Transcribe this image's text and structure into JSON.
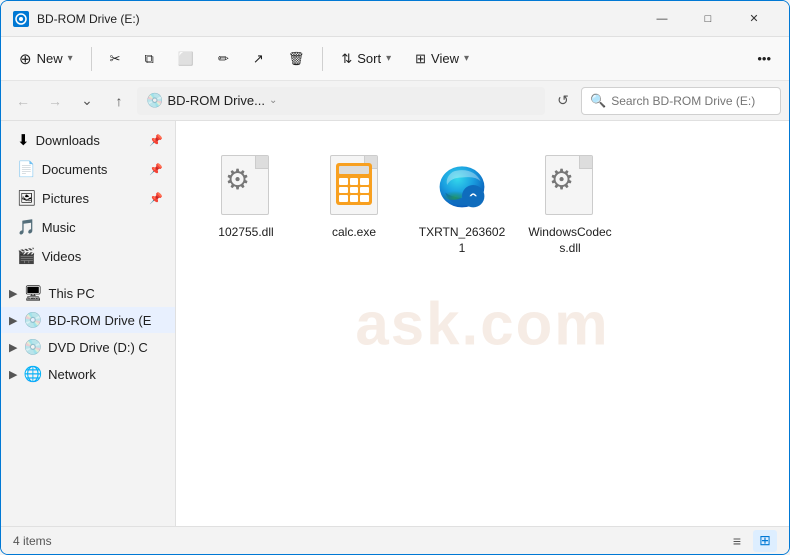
{
  "window": {
    "title": "BD-ROM Drive (E:)",
    "icon": "disc-icon"
  },
  "toolbar": {
    "new_label": "New",
    "new_chevron": "▾",
    "cut_icon": "✂",
    "copy_icon": "⧉",
    "paste_icon": "📋",
    "rename_icon": "✏",
    "share_icon": "↗",
    "delete_icon": "🗑",
    "sort_label": "Sort",
    "sort_icon": "⇅",
    "view_label": "View",
    "view_icon": "⊞",
    "more_icon": "•••"
  },
  "addressbar": {
    "back_disabled": true,
    "forward_disabled": true,
    "up_enabled": true,
    "path_icon": "💿",
    "path_text": "BD-ROM Drive...",
    "search_placeholder": "Search BD-ROM Drive (E:)"
  },
  "sidebar": {
    "quick_access": [
      {
        "id": "downloads",
        "label": "Downloads",
        "icon": "⬇",
        "pinned": true
      },
      {
        "id": "documents",
        "label": "Documents",
        "icon": "📄",
        "pinned": true
      },
      {
        "id": "pictures",
        "label": "Pictures",
        "icon": "🖼",
        "pinned": true
      },
      {
        "id": "music",
        "label": "Music",
        "icon": "🎵",
        "pinned": false
      },
      {
        "id": "videos",
        "label": "Videos",
        "icon": "🎬",
        "pinned": false
      }
    ],
    "sections": [
      {
        "id": "this-pc",
        "label": "This PC",
        "icon": "🖥",
        "expanded": false
      },
      {
        "id": "bdrom",
        "label": "BD-ROM Drive (E",
        "icon": "💿",
        "expanded": true
      },
      {
        "id": "dvd",
        "label": "DVD Drive (D:) C",
        "icon": "💿",
        "expanded": false
      },
      {
        "id": "network",
        "label": "Network",
        "icon": "🌐",
        "expanded": false
      }
    ]
  },
  "files": [
    {
      "id": "file-dll1",
      "name": "102755.dll",
      "type": "dll"
    },
    {
      "id": "file-calc",
      "name": "calc.exe",
      "type": "calc"
    },
    {
      "id": "file-txrtn",
      "name": "TXRTN_2636021",
      "type": "edge"
    },
    {
      "id": "file-codecs",
      "name": "WindowsCodecs.dll",
      "type": "dll2"
    }
  ],
  "statusbar": {
    "items_label": "4 items",
    "view_list_icon": "≡",
    "view_grid_icon": "⊞"
  },
  "titlebar_controls": {
    "minimize": "—",
    "maximize": "□",
    "close": "✕"
  }
}
